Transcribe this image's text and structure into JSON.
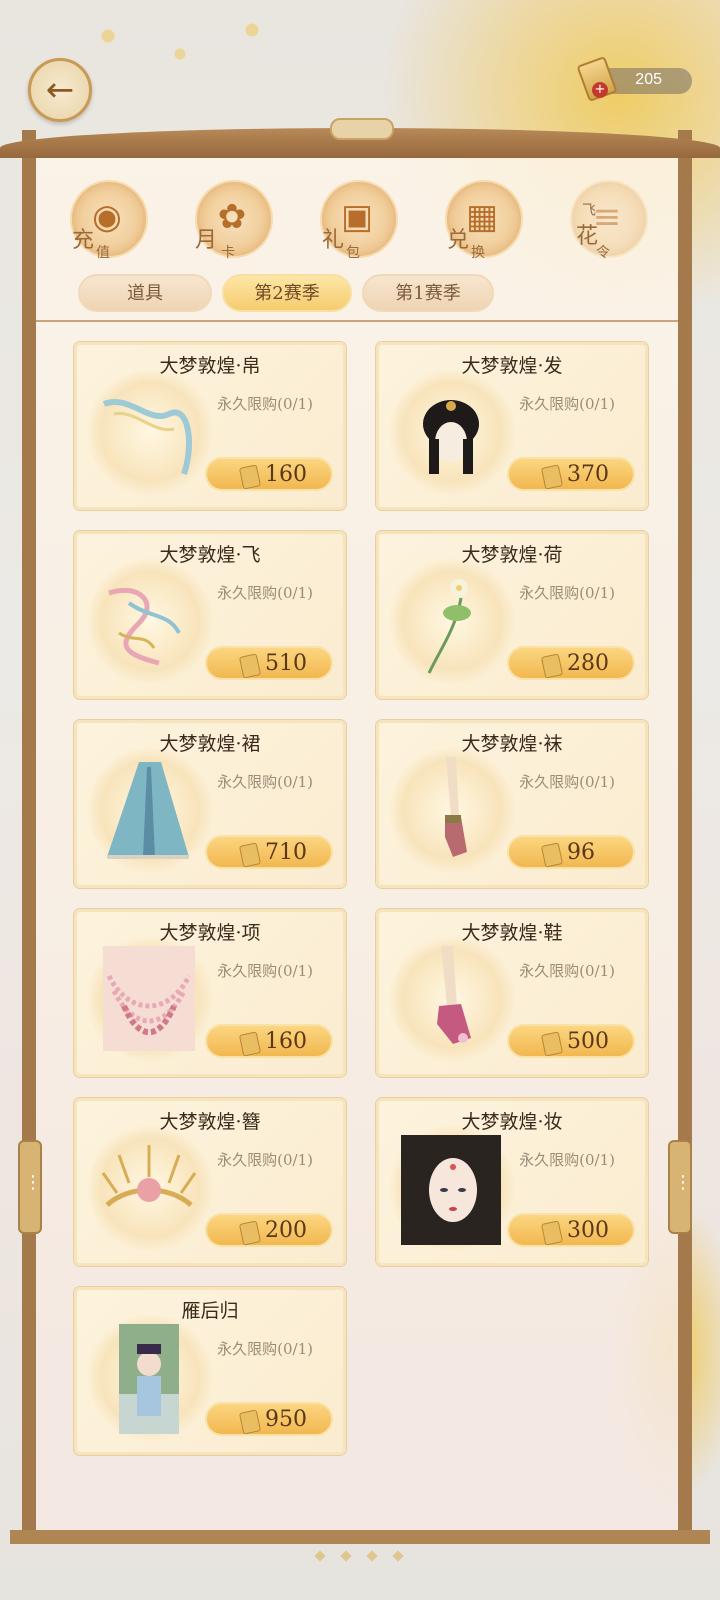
{
  "header": {
    "back_icon": "back-arrow-icon",
    "currency_value": "205",
    "currency_icon": "scroll-coin-icon",
    "currency_add": "+"
  },
  "categories": [
    {
      "label_main": "充",
      "label_sub": "值",
      "icon": "coin-icon"
    },
    {
      "label_main": "月",
      "label_sub": "卡",
      "icon": "card-icon"
    },
    {
      "label_main": "礼",
      "label_sub": "包",
      "icon": "gift-box-icon"
    },
    {
      "label_main": "兑",
      "label_sub": "换",
      "icon": "exchange-box-icon"
    },
    {
      "label_main": "花",
      "label_sub": "令",
      "label_top": "飞",
      "icon": "scroll-icon"
    }
  ],
  "tabs": [
    {
      "label": "道具",
      "active": false
    },
    {
      "label": "第2赛季",
      "active": true
    },
    {
      "label": "第1赛季",
      "active": false
    }
  ],
  "items": [
    {
      "title": "大梦敦煌·帛",
      "limit": "永久限购(0/1)",
      "price": "160",
      "art": "ribbon-icon"
    },
    {
      "title": "大梦敦煌·发",
      "limit": "永久限购(0/1)",
      "price": "370",
      "art": "hair-icon"
    },
    {
      "title": "大梦敦煌·飞",
      "limit": "永久限购(0/1)",
      "price": "510",
      "art": "flying-ribbon-icon"
    },
    {
      "title": "大梦敦煌·荷",
      "limit": "永久限购(0/1)",
      "price": "280",
      "art": "lotus-icon"
    },
    {
      "title": "大梦敦煌·裙",
      "limit": "永久限购(0/1)",
      "price": "710",
      "art": "skirt-icon"
    },
    {
      "title": "大梦敦煌·袜",
      "limit": "永久限购(0/1)",
      "price": "96",
      "art": "socks-icon"
    },
    {
      "title": "大梦敦煌·项",
      "limit": "永久限购(0/1)",
      "price": "160",
      "art": "necklace-icon"
    },
    {
      "title": "大梦敦煌·鞋",
      "limit": "永久限购(0/1)",
      "price": "500",
      "art": "shoe-icon"
    },
    {
      "title": "大梦敦煌·簪",
      "limit": "永久限购(0/1)",
      "price": "200",
      "art": "hairpin-icon"
    },
    {
      "title": "大梦敦煌·妆",
      "limit": "永久限购(0/1)",
      "price": "300",
      "art": "makeup-portrait-icon"
    },
    {
      "title": "雁后归",
      "limit": "永久限购(0/1)",
      "price": "950",
      "art": "scene-icon"
    }
  ],
  "colors": {
    "frame": "#a4794b",
    "price_pill": "#f2b850",
    "active_tab": "#f6cc6e",
    "title_text": "#3b2a1c"
  }
}
